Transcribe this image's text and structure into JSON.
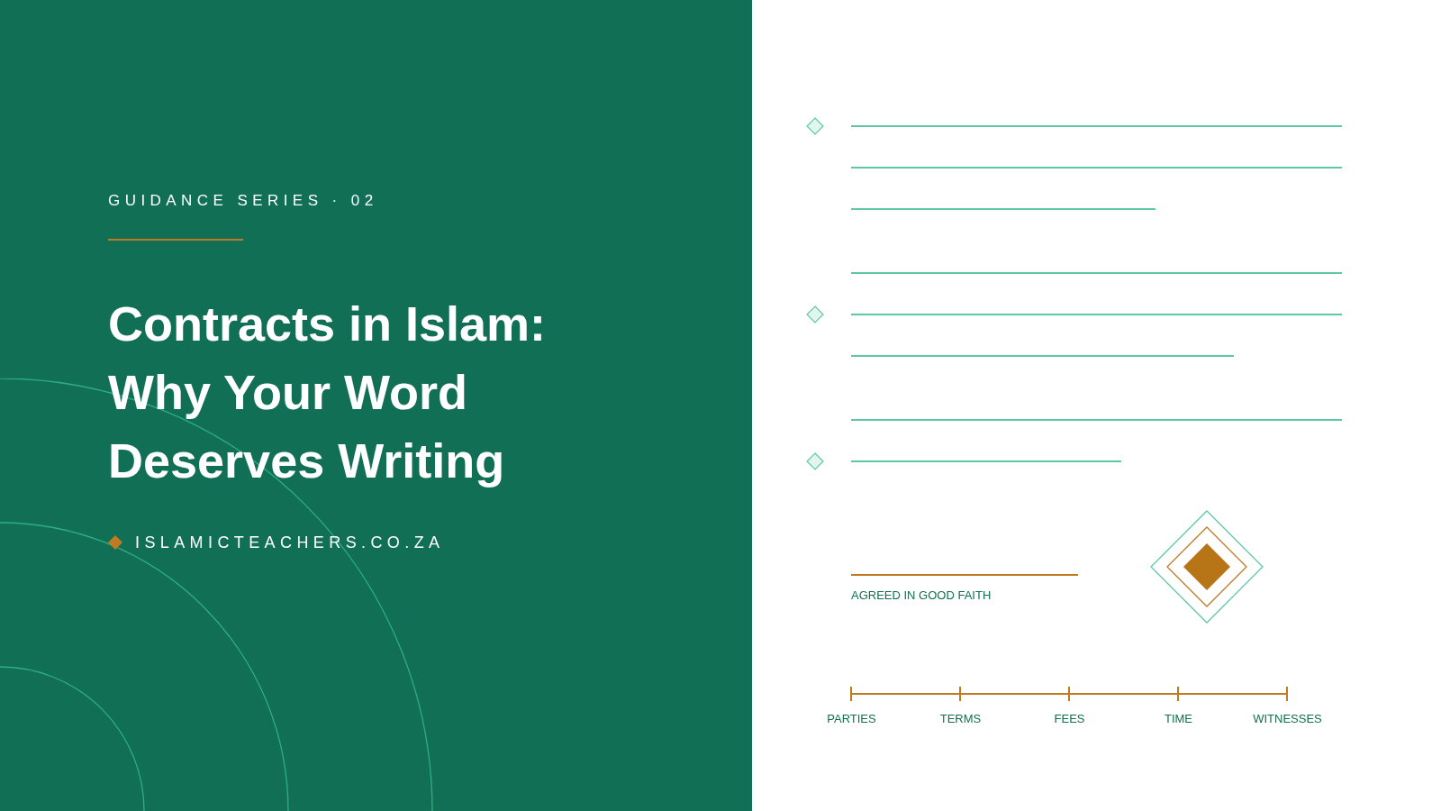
{
  "eyebrow": "GUIDANCE SERIES · 02",
  "title": "Contracts in Islam: Why Your Word Deserves Writing",
  "website": "ISLAMICTEACHERS.CO.ZA",
  "signature": {
    "label": "AGREED IN GOOD FAITH"
  },
  "timeline": [
    "PARTIES",
    "TERMS",
    "FEES",
    "TIME",
    "WITNESSES"
  ]
}
